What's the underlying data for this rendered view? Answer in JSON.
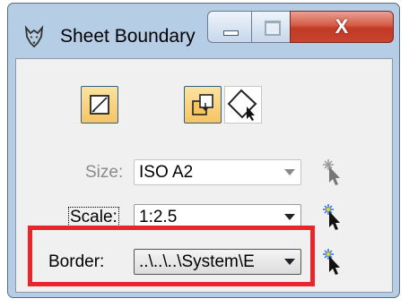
{
  "window": {
    "title": "Sheet Boundary",
    "app_icon": "wolf-head-icon",
    "controls": {
      "minimize": "minimize-icon",
      "maximize": "maximize-icon",
      "close_glyph": "X"
    }
  },
  "toolbar": {
    "buttons": [
      {
        "icon": "boundary-placement-icon",
        "active": true
      },
      {
        "icon": "sheet-placement-icon",
        "active": true
      },
      {
        "icon": "rotate-boundary-icon",
        "active": false
      }
    ]
  },
  "fields": {
    "size": {
      "label": "Size:",
      "value": "ISO A2",
      "enabled": false
    },
    "scale": {
      "label": "Scale:",
      "value": "1:2.5",
      "enabled": true
    },
    "border": {
      "label": "Border:",
      "value": "..\\..\\..\\System\\E",
      "enabled": true
    }
  },
  "icons": {
    "pick_cursor": "pick-cursor-icon"
  },
  "colors": {
    "title_bar": "#b6cde6",
    "close_button": "#c7442e",
    "active_tool": "#f6c463",
    "highlight_box": "#e8262b"
  }
}
